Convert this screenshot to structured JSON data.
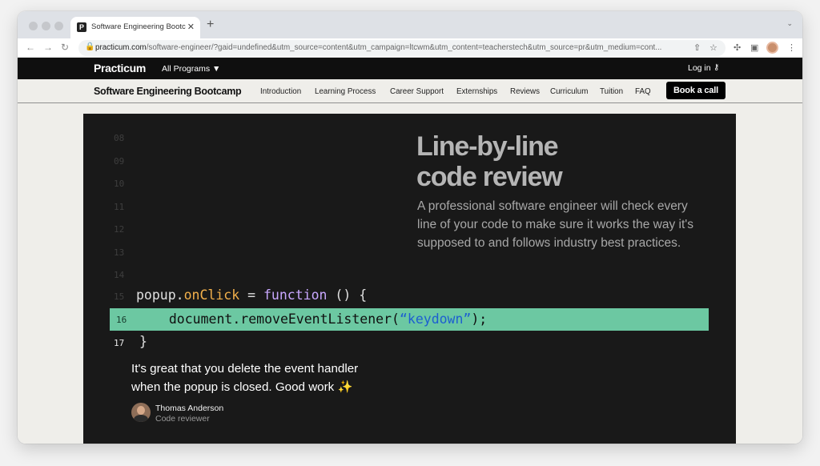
{
  "browser": {
    "tab_title": "Software Engineering Bootcamp",
    "favicon_letter": "P",
    "url_host": "practicum.com",
    "url_path": "/software-engineer/?gaid=undefined&utm_source=content&utm_campaign=ltcwm&utm_content=teacherstech&utm_source=pr&utm_medium=cont..."
  },
  "topbar": {
    "logo": "Practicum",
    "programs": "All Programs ▼",
    "login": "Log in"
  },
  "subnav": {
    "brand": "Software Engineering Bootcamp",
    "links": [
      "Introduction",
      "Learning Process",
      "Career Support",
      "Externships",
      "Reviews",
      "Curriculum",
      "Tuition",
      "FAQ"
    ],
    "cta": "Book a call"
  },
  "code": {
    "line_numbers": [
      "08",
      "09",
      "10",
      "11",
      "12",
      "13",
      "14",
      "15",
      "16",
      "17"
    ],
    "line15": {
      "obj": "popup",
      "dot": ".",
      "method": "onClick",
      "eq": " = ",
      "kw": "function",
      "rest": " () {"
    },
    "line16": {
      "pre": "  document.removeEventListener(",
      "str": "“keydown”",
      "post": ");"
    },
    "line17": "}"
  },
  "feature": {
    "headline_line1": "Line-by-line",
    "headline_line2": "code review",
    "description": "A professional software engineer will check every line of your code to make sure it works the way it's supposed to and follows industry best practices."
  },
  "review": {
    "comment": "It's great that you delete the event handler when the popup is closed. Good work ✨",
    "name": "Thomas Anderson",
    "role": "Code reviewer"
  },
  "colors": {
    "highlight": "#6cc8a2",
    "keyword": "#c9a8ff",
    "method": "#f2b04b",
    "string": "#2f78d8"
  }
}
